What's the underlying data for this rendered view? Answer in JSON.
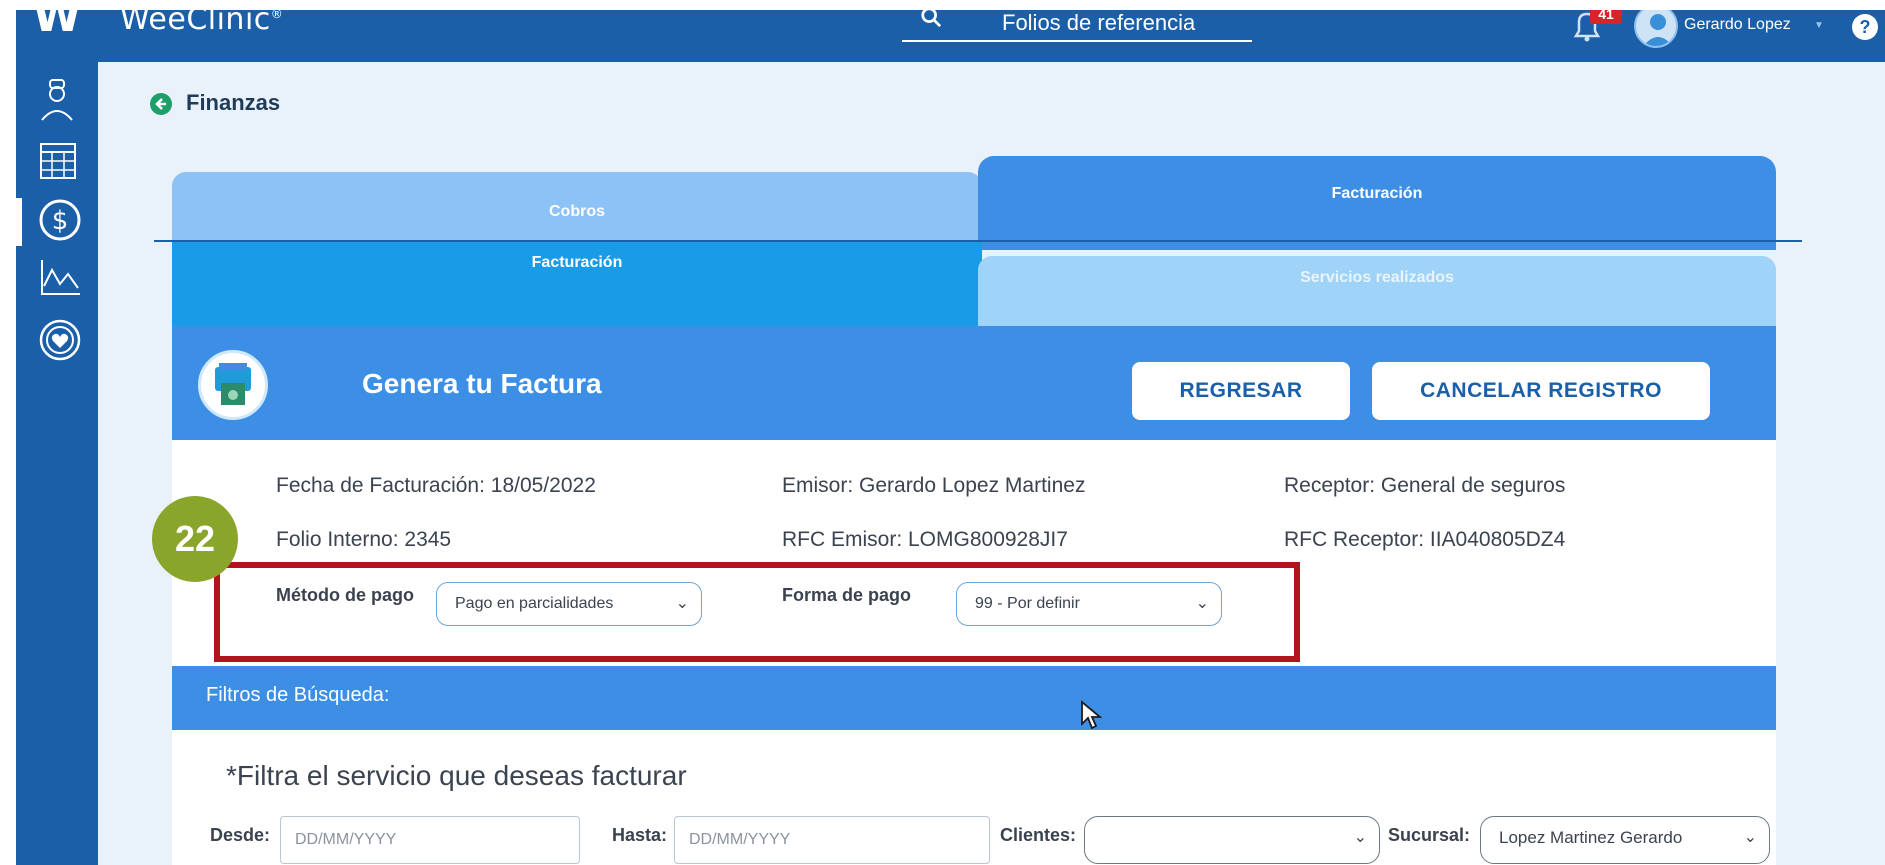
{
  "app": {
    "brand": "WeeClinic",
    "brand_suffix": "®",
    "colors": {
      "primary": "#1a5fa8",
      "accent": "#3d8fe6",
      "highlight": "#b0151e",
      "badge": "#8aa52c"
    }
  },
  "header": {
    "search_label": "Folios de referencia",
    "notifications_count": "41",
    "user_name": "Gerardo Lopez",
    "help": "?"
  },
  "sidebar": {
    "items": [
      {
        "icon": "doctor-icon"
      },
      {
        "icon": "calendar-icon"
      },
      {
        "icon": "dollar-icon",
        "active": true
      },
      {
        "icon": "chart-icon"
      },
      {
        "icon": "heart-icon"
      }
    ]
  },
  "page": {
    "title": "Finanzas"
  },
  "tabs": {
    "main": [
      {
        "label": "Cobros"
      },
      {
        "label": "Facturación",
        "active": true
      }
    ],
    "sub": [
      {
        "label": "Facturación",
        "active": true
      },
      {
        "label": "Servicios realizados"
      }
    ]
  },
  "invoice": {
    "title": "Genera tu Factura",
    "back_button": "REGRESAR",
    "cancel_button": "CANCELAR REGISTRO",
    "fecha": "Fecha de Facturación: 18/05/2022",
    "folio": "Folio Interno: 2345",
    "emisor": "Emisor: Gerardo Lopez Martinez",
    "rfc_emisor": "RFC Emisor: LOMG800928JI7",
    "receptor": "Receptor: General de seguros",
    "rfc_receptor": "RFC Receptor: IIA040805DZ4",
    "metodo_label": "Método de pago",
    "metodo_value": "Pago en parcialidades",
    "forma_label": "Forma de pago",
    "forma_value": "99 - Por definir"
  },
  "step_badge": "22",
  "filters": {
    "title": "Filtros de Búsqueda:",
    "hint": "*Filtra el servicio que deseas facturar",
    "desde_label": "Desde:",
    "desde_placeholder": "DD/MM/YYYY",
    "hasta_label": "Hasta:",
    "hasta_placeholder": "DD/MM/YYYY",
    "clientes_label": "Clientes:",
    "clientes_value": "",
    "sucursal_label": "Sucursal:",
    "sucursal_value": "Lopez Martinez Gerardo"
  }
}
